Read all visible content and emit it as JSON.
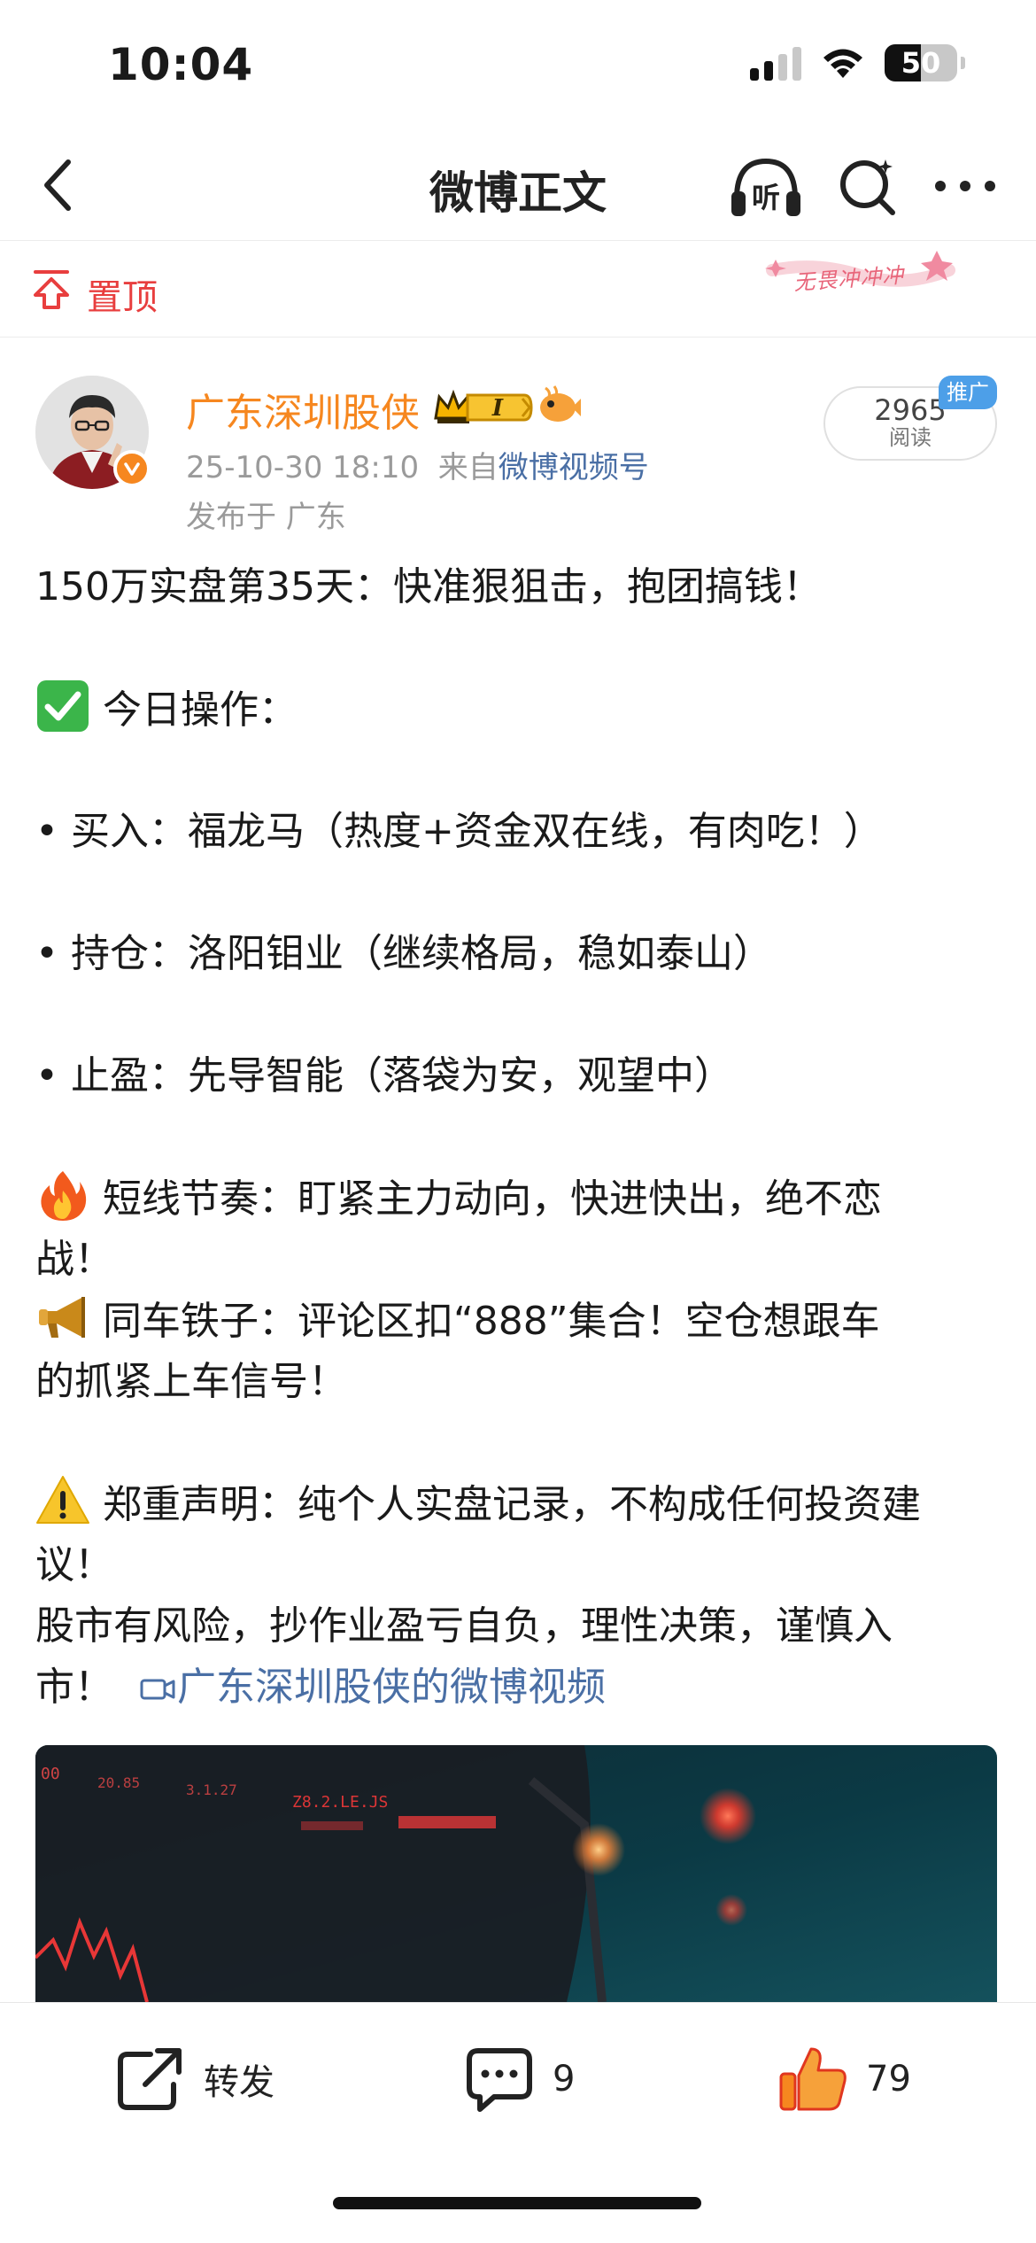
{
  "status_bar": {
    "time": "10:04",
    "battery": "50",
    "battery_level": 0.5
  },
  "nav": {
    "title": "微博正文",
    "listen_icon_text": "听"
  },
  "pin": {
    "label": "置顶",
    "sticker_text": "无畏冲冲冲"
  },
  "post": {
    "author": "广东深圳股侠",
    "timestamp": "25-10-30 18:10",
    "source_prefix": "来自",
    "source": "微博视频号",
    "location": "发布于 广东",
    "read_count": "2965",
    "read_label": "阅读",
    "promo_tag": "推广",
    "vip_level": "I",
    "lines": {
      "title": "150万实盘第35天：快准狠狙击，抱团搞钱！",
      "ops_heading": "今日操作：",
      "buy": "• 买入：福龙马（热度+资金双在线，有肉吃！）",
      "hold": "• 持仓：洛阳钼业（继续格局，稳如泰山）",
      "sell": "• 止盈：先导智能（落袋为安，观望中）",
      "rhythm_a": "短线节奏：盯紧主力动向，快进快出，绝不恋",
      "rhythm_b": "战！",
      "crew_a": "同车铁子：评论区扣“888”集合！空仓想跟车",
      "crew_b": "的抓紧上车信号！",
      "disclaimer_a": "郑重声明：纯个人实盘记录，不构成任何投资建",
      "disclaimer_b": "议！",
      "risk_a": "股市有风险，抄作业盈亏自负，理性决策，谨慎入",
      "risk_b": "市！",
      "video_link": "广东深圳股侠的微博视频"
    },
    "image_ticker_labels": [
      "00",
      "20.85",
      "3.1.27",
      "Z8.2.LE.JS"
    ]
  },
  "actions": {
    "repost_label": "转发",
    "comment_count": "9",
    "like_count": "79"
  },
  "colors": {
    "accent_orange": "#f6871f",
    "link_blue": "#4a6fa5",
    "pin_red": "#e83e3e",
    "promo_blue": "#4d9fe8"
  }
}
